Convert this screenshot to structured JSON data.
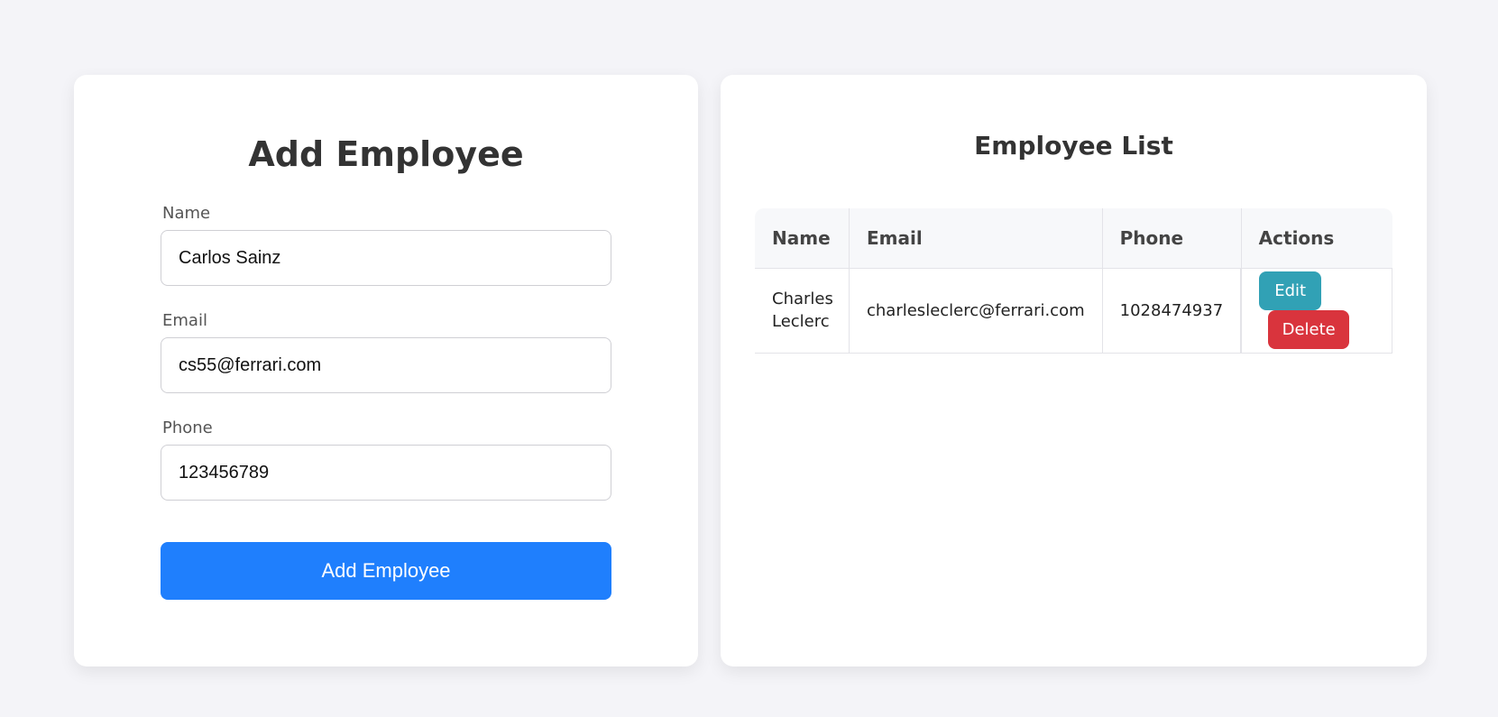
{
  "form": {
    "title": "Add Employee",
    "name_label": "Name",
    "name_value": "Carlos Sainz",
    "email_label": "Email",
    "email_value": "cs55@ferrari.com",
    "phone_label": "Phone",
    "phone_value": "123456789",
    "submit_label": "Add Employee"
  },
  "list": {
    "title": "Employee List",
    "columns": [
      "Name",
      "Email",
      "Phone",
      "Actions"
    ],
    "rows": [
      {
        "name": "Charles Leclerc",
        "email": "charlesleclerc@ferrari.com",
        "phone": "1028474937",
        "edit_label": "Edit",
        "delete_label": "Delete"
      }
    ]
  },
  "colors": {
    "primary": "#1f7ffd",
    "edit": "#31a1b5",
    "delete": "#d9343d",
    "background": "#f4f4f8"
  }
}
